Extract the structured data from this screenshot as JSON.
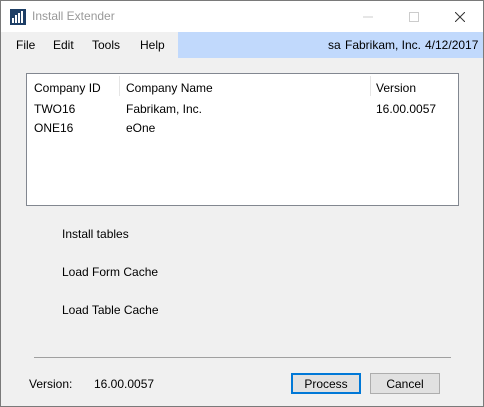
{
  "window": {
    "title": "Install Extender",
    "icon": "bar-chart-app-icon",
    "controls": [
      "minimize-icon",
      "maximize-icon",
      "close-icon"
    ]
  },
  "menu": {
    "file": "File",
    "edit": "Edit",
    "tools": "Tools",
    "help": "Help"
  },
  "info": {
    "user": "sa",
    "company": "Fabrikam, Inc.",
    "date": "4/12/2017"
  },
  "table": {
    "headers": {
      "company_id": "Company ID",
      "company_name": "Company Name",
      "version": "Version"
    },
    "rows": [
      {
        "company_id": "TWO16",
        "company_name": "Fabrikam, Inc.",
        "version": "16.00.0057"
      },
      {
        "company_id": "ONE16",
        "company_name": "eOne",
        "version": ""
      }
    ]
  },
  "status": {
    "install_tables": "Install tables",
    "load_form_cache": "Load Form Cache",
    "load_table_cache": "Load Table Cache"
  },
  "footer": {
    "version_label": "Version:",
    "version_value": "16.00.0057",
    "process_label": "Process",
    "cancel_label": "Cancel"
  },
  "colors": {
    "info_strip": "#c1d9fc",
    "default_button_border": "#0078d7",
    "icon_blue": "#1e3f66"
  }
}
